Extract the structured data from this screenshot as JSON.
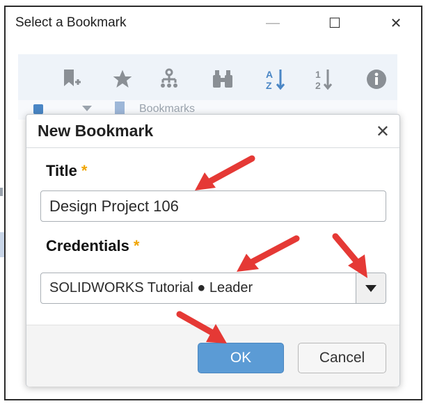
{
  "window": {
    "title": "Select a Bookmark",
    "minimize_glyph": "—",
    "maximize_glyph": "☐",
    "close_glyph": "✕"
  },
  "toolbar": {
    "icons": [
      "bookmark-add-icon",
      "star-icon",
      "hierarchy-icon",
      "binoculars-icon",
      "sort-alpha-icon",
      "sort-numeric-icon",
      "info-icon"
    ]
  },
  "background_row": {
    "label": "Bookmarks"
  },
  "dialog": {
    "title": "New Bookmark",
    "close_glyph": "✕",
    "title_label": "Title",
    "required_mark": "*",
    "title_value": "Design Project 106",
    "credentials_label": "Credentials",
    "credentials_value": "SOLIDWORKS Tutorial ● Leader",
    "ok_label": "OK",
    "cancel_label": "Cancel"
  },
  "colors": {
    "accent_button": "#5b9bd5",
    "required_star": "#f0a400",
    "callout_arrow": "#e53935",
    "toolbar_icon_gray": "#8a8f95",
    "toolbar_icon_blue": "#4a86c5"
  }
}
